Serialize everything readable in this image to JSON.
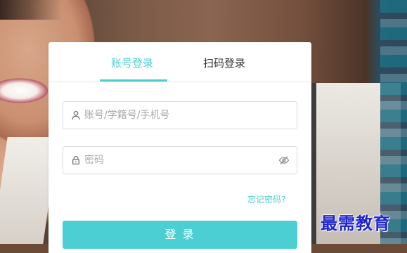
{
  "tabs": {
    "account_login": "账号登录",
    "qrcode_login": "扫码登录"
  },
  "form": {
    "username_placeholder": "账号/学籍号/手机号",
    "password_placeholder": "密码",
    "forgot_password": "忘记密码?",
    "login_button": "登 录"
  },
  "watermark": {
    "text": "最需教育"
  },
  "icons": {
    "username": "user-icon",
    "password": "lock-icon",
    "visibility": "eye-off-icon"
  },
  "colors": {
    "accent": "#4ccfd3",
    "text": "#333333",
    "placeholder": "#a9a9a9",
    "watermark": "#2024cf"
  }
}
